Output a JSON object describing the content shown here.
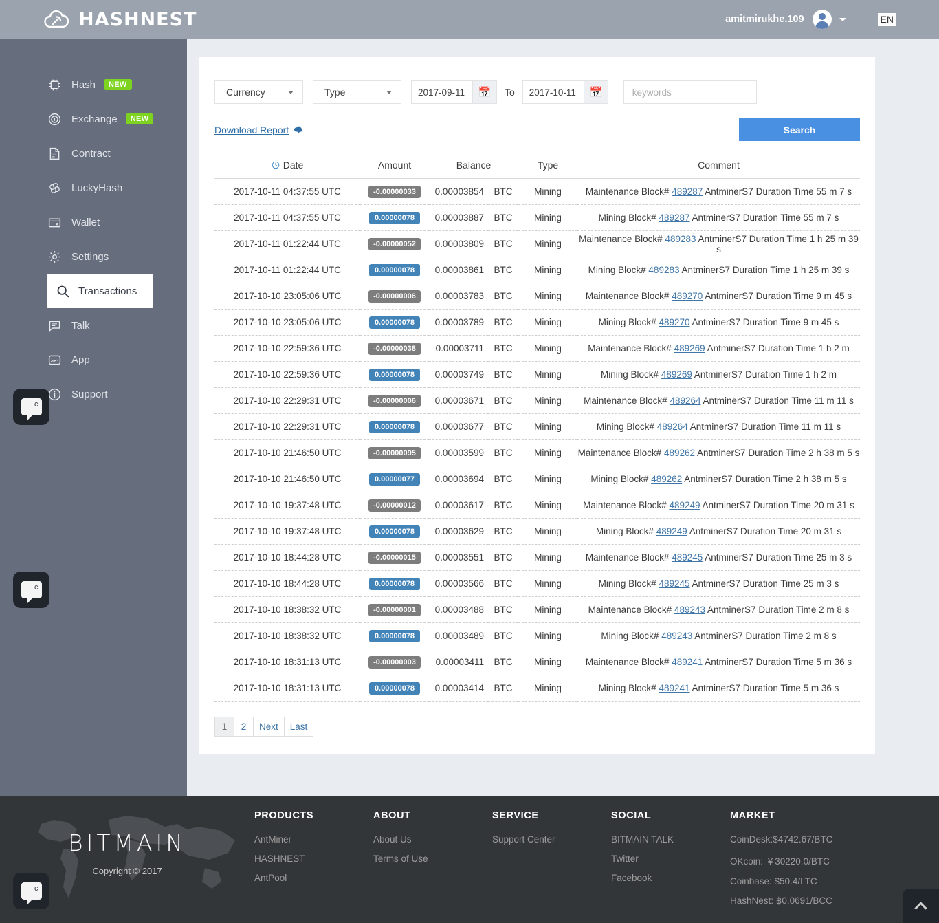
{
  "header": {
    "brand": "HASHNEST",
    "brand_icon": "cloud-pickaxe-icon",
    "user_name": "amitmirukhe.109",
    "lang": "EN"
  },
  "sidebar": {
    "items": [
      {
        "label": "Hash",
        "icon": "chip-icon",
        "badge": "NEW",
        "active": false
      },
      {
        "label": "Exchange",
        "icon": "coin-icon",
        "badge": "NEW",
        "active": false
      },
      {
        "label": "Contract",
        "icon": "document-icon",
        "badge": "",
        "active": false
      },
      {
        "label": "LuckyHash",
        "icon": "clover-icon",
        "badge": "",
        "active": false
      },
      {
        "label": "Wallet",
        "icon": "wallet-icon",
        "badge": "",
        "active": false
      },
      {
        "label": "Settings",
        "icon": "gear-icon",
        "badge": "",
        "active": false
      },
      {
        "label": "Transactions",
        "icon": "search-icon",
        "badge": "",
        "active": true
      },
      {
        "label": "Talk",
        "icon": "chat-icon",
        "badge": "",
        "active": false
      },
      {
        "label": "App",
        "icon": "app-icon",
        "badge": "",
        "active": false
      },
      {
        "label": "Support",
        "icon": "info-icon",
        "badge": "",
        "active": false
      }
    ]
  },
  "chat_widget": {
    "letter": "c"
  },
  "filters": {
    "currency_label": "Currency",
    "type_label": "Type",
    "date_from": "2017-09-11",
    "date_to": "2017-10-11",
    "to_label": "To",
    "keywords_value": "",
    "keywords_placeholder": "keywords",
    "download_label": "Download Report",
    "download_icon": "cloud-download-icon",
    "search_label": "Search",
    "calendar_icon": "calendar-icon"
  },
  "table": {
    "columns": [
      "Date",
      "Amount",
      "Balance",
      "Type",
      "Comment"
    ],
    "sort_icon": "clock-icon",
    "rows": [
      {
        "date": "2017-10-11 04:37:55 UTC",
        "amount": "-0.00000033",
        "sign": "neg",
        "balance": "0.00003854",
        "currency": "BTC",
        "type": "Mining",
        "comment_pre": "Maintenance Block#",
        "comment_link": "489287",
        "comment_post": "AntminerS7 Duration Time 55 m 7 s"
      },
      {
        "date": "2017-10-11 04:37:55 UTC",
        "amount": "0.00000078",
        "sign": "pos",
        "balance": "0.00003887",
        "currency": "BTC",
        "type": "Mining",
        "comment_pre": "Mining Block#",
        "comment_link": "489287",
        "comment_post": "AntminerS7 Duration Time 55 m 7 s"
      },
      {
        "date": "2017-10-11 01:22:44 UTC",
        "amount": "-0.00000052",
        "sign": "neg",
        "balance": "0.00003809",
        "currency": "BTC",
        "type": "Mining",
        "comment_pre": "Maintenance Block#",
        "comment_link": "489283",
        "comment_post": "AntminerS7 Duration Time 1 h 25 m 39 s"
      },
      {
        "date": "2017-10-11 01:22:44 UTC",
        "amount": "0.00000078",
        "sign": "pos",
        "balance": "0.00003861",
        "currency": "BTC",
        "type": "Mining",
        "comment_pre": "Mining Block#",
        "comment_link": "489283",
        "comment_post": "AntminerS7 Duration Time 1 h 25 m 39 s"
      },
      {
        "date": "2017-10-10 23:05:06 UTC",
        "amount": "-0.00000006",
        "sign": "neg",
        "balance": "0.00003783",
        "currency": "BTC",
        "type": "Mining",
        "comment_pre": "Maintenance Block#",
        "comment_link": "489270",
        "comment_post": "AntminerS7 Duration Time 9 m 45 s"
      },
      {
        "date": "2017-10-10 23:05:06 UTC",
        "amount": "0.00000078",
        "sign": "pos",
        "balance": "0.00003789",
        "currency": "BTC",
        "type": "Mining",
        "comment_pre": "Mining Block#",
        "comment_link": "489270",
        "comment_post": "AntminerS7 Duration Time 9 m 45 s"
      },
      {
        "date": "2017-10-10 22:59:36 UTC",
        "amount": "-0.00000038",
        "sign": "neg",
        "balance": "0.00003711",
        "currency": "BTC",
        "type": "Mining",
        "comment_pre": "Maintenance Block#",
        "comment_link": "489269",
        "comment_post": "AntminerS7 Duration Time 1 h 2 m"
      },
      {
        "date": "2017-10-10 22:59:36 UTC",
        "amount": "0.00000078",
        "sign": "pos",
        "balance": "0.00003749",
        "currency": "BTC",
        "type": "Mining",
        "comment_pre": "Mining Block#",
        "comment_link": "489269",
        "comment_post": "AntminerS7 Duration Time 1 h 2 m"
      },
      {
        "date": "2017-10-10 22:29:31 UTC",
        "amount": "-0.00000006",
        "sign": "neg",
        "balance": "0.00003671",
        "currency": "BTC",
        "type": "Mining",
        "comment_pre": "Maintenance Block#",
        "comment_link": "489264",
        "comment_post": "AntminerS7 Duration Time 11 m 11 s"
      },
      {
        "date": "2017-10-10 22:29:31 UTC",
        "amount": "0.00000078",
        "sign": "pos",
        "balance": "0.00003677",
        "currency": "BTC",
        "type": "Mining",
        "comment_pre": "Mining Block#",
        "comment_link": "489264",
        "comment_post": "AntminerS7 Duration Time 11 m 11 s"
      },
      {
        "date": "2017-10-10 21:46:50 UTC",
        "amount": "-0.00000095",
        "sign": "neg",
        "balance": "0.00003599",
        "currency": "BTC",
        "type": "Mining",
        "comment_pre": "Maintenance Block#",
        "comment_link": "489262",
        "comment_post": "AntminerS7 Duration Time 2 h 38 m 5 s"
      },
      {
        "date": "2017-10-10 21:46:50 UTC",
        "amount": "0.00000077",
        "sign": "pos",
        "balance": "0.00003694",
        "currency": "BTC",
        "type": "Mining",
        "comment_pre": "Mining Block#",
        "comment_link": "489262",
        "comment_post": "AntminerS7 Duration Time 2 h 38 m 5 s"
      },
      {
        "date": "2017-10-10 19:37:48 UTC",
        "amount": "-0.00000012",
        "sign": "neg",
        "balance": "0.00003617",
        "currency": "BTC",
        "type": "Mining",
        "comment_pre": "Maintenance Block#",
        "comment_link": "489249",
        "comment_post": "AntminerS7 Duration Time 20 m 31 s"
      },
      {
        "date": "2017-10-10 19:37:48 UTC",
        "amount": "0.00000078",
        "sign": "pos",
        "balance": "0.00003629",
        "currency": "BTC",
        "type": "Mining",
        "comment_pre": "Mining Block#",
        "comment_link": "489249",
        "comment_post": "AntminerS7 Duration Time 20 m 31 s"
      },
      {
        "date": "2017-10-10 18:44:28 UTC",
        "amount": "-0.00000015",
        "sign": "neg",
        "balance": "0.00003551",
        "currency": "BTC",
        "type": "Mining",
        "comment_pre": "Maintenance Block#",
        "comment_link": "489245",
        "comment_post": "AntminerS7 Duration Time 25 m 3 s"
      },
      {
        "date": "2017-10-10 18:44:28 UTC",
        "amount": "0.00000078",
        "sign": "pos",
        "balance": "0.00003566",
        "currency": "BTC",
        "type": "Mining",
        "comment_pre": "Mining Block#",
        "comment_link": "489245",
        "comment_post": "AntminerS7 Duration Time 25 m 3 s"
      },
      {
        "date": "2017-10-10 18:38:32 UTC",
        "amount": "-0.00000001",
        "sign": "neg",
        "balance": "0.00003488",
        "currency": "BTC",
        "type": "Mining",
        "comment_pre": "Maintenance Block#",
        "comment_link": "489243",
        "comment_post": "AntminerS7 Duration Time 2 m 8 s"
      },
      {
        "date": "2017-10-10 18:38:32 UTC",
        "amount": "0.00000078",
        "sign": "pos",
        "balance": "0.00003489",
        "currency": "BTC",
        "type": "Mining",
        "comment_pre": "Mining Block#",
        "comment_link": "489243",
        "comment_post": "AntminerS7 Duration Time 2 m 8 s"
      },
      {
        "date": "2017-10-10 18:31:13 UTC",
        "amount": "-0.00000003",
        "sign": "neg",
        "balance": "0.00003411",
        "currency": "BTC",
        "type": "Mining",
        "comment_pre": "Maintenance Block#",
        "comment_link": "489241",
        "comment_post": "AntminerS7 Duration Time 5 m 36 s"
      },
      {
        "date": "2017-10-10 18:31:13 UTC",
        "amount": "0.00000078",
        "sign": "pos",
        "balance": "0.00003414",
        "currency": "BTC",
        "type": "Mining",
        "comment_pre": "Mining Block#",
        "comment_link": "489241",
        "comment_post": "AntminerS7 Duration Time 5 m 36 s"
      }
    ]
  },
  "pagination": {
    "pages": [
      "1",
      "2",
      "Next",
      "Last"
    ],
    "current": "1"
  },
  "footer": {
    "brand": "BITMAIN",
    "copyright": "Copyright © 2017",
    "columns": [
      {
        "title": "PRODUCTS",
        "links": [
          "AntMiner",
          "HASHNEST",
          "AntPool"
        ]
      },
      {
        "title": "ABOUT",
        "links": [
          "About Us",
          "Terms of Use"
        ]
      },
      {
        "title": "SERVICE",
        "links": [
          "Support Center"
        ]
      },
      {
        "title": "SOCIAL",
        "links": [
          "BITMAIN TALK",
          "Twitter",
          "Facebook"
        ]
      },
      {
        "title": "MARKET",
        "links": [
          "CoinDesk:$4742.67/BTC",
          "OKcoin: ￥30220.0/BTC",
          "Coinbase: $50.4/LTC",
          "HashNest: ฿0.0691/BCC"
        ]
      }
    ],
    "to_top_icon": "chevron-up-icon"
  },
  "colors": {
    "topbar": "#9ba3ae",
    "sidebar": "#666d7d",
    "accent_blue": "#4a90e2",
    "badge_pos": "#4283b8",
    "badge_neg": "#7d7d7d",
    "badge_new": "#7ed321",
    "footer": "#333639",
    "link": "#4076a8"
  }
}
